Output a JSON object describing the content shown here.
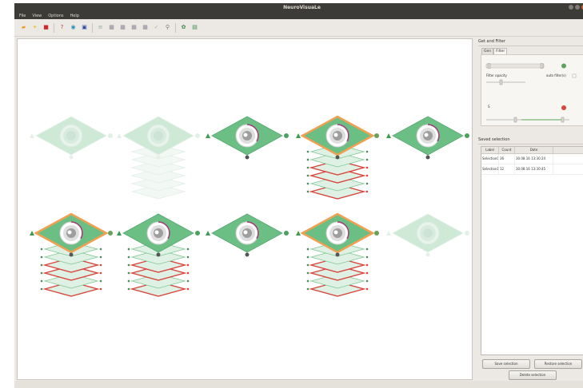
{
  "app": {
    "title": "NeuroVisuaLe",
    "menu": [
      "File",
      "View",
      "Options",
      "Help"
    ]
  },
  "toolbar": {
    "icons": [
      "folder-open-icon",
      "star-icon",
      "stop-icon",
      "help-icon",
      "circle-icon",
      "camera-icon",
      "layers-icon",
      "image-icon",
      "grid-icon",
      "grid2-icon",
      "grid3-icon",
      "check-icon",
      "search-icon",
      "gear-icon",
      "cube-icon"
    ]
  },
  "layer_controls": {
    "title": "Get and Filter",
    "tabs": [
      "Gen",
      "Filter"
    ],
    "filter_opacity_label": "Filter opacity",
    "auto_filter_label": "auto filter(s)",
    "s_label": "S"
  },
  "saved_selection": {
    "title": "Saved selection",
    "columns": [
      "Label",
      "Count",
      "Date"
    ],
    "rows": [
      {
        "label": "Selection0",
        "count": "36",
        "date": "30.08.16 13:30:24"
      },
      {
        "label": "Selection1",
        "count": "12",
        "date": "30.08.16 13:30:45"
      }
    ],
    "buttons": {
      "save": "Save selection",
      "restore": "Restore selection",
      "delete": "Delete selection"
    }
  },
  "colors": {
    "node_green": "#6cbf84",
    "node_green_light": "#cfe9d7",
    "highlight": "#f0a050",
    "stack_red": "#d9453c"
  }
}
